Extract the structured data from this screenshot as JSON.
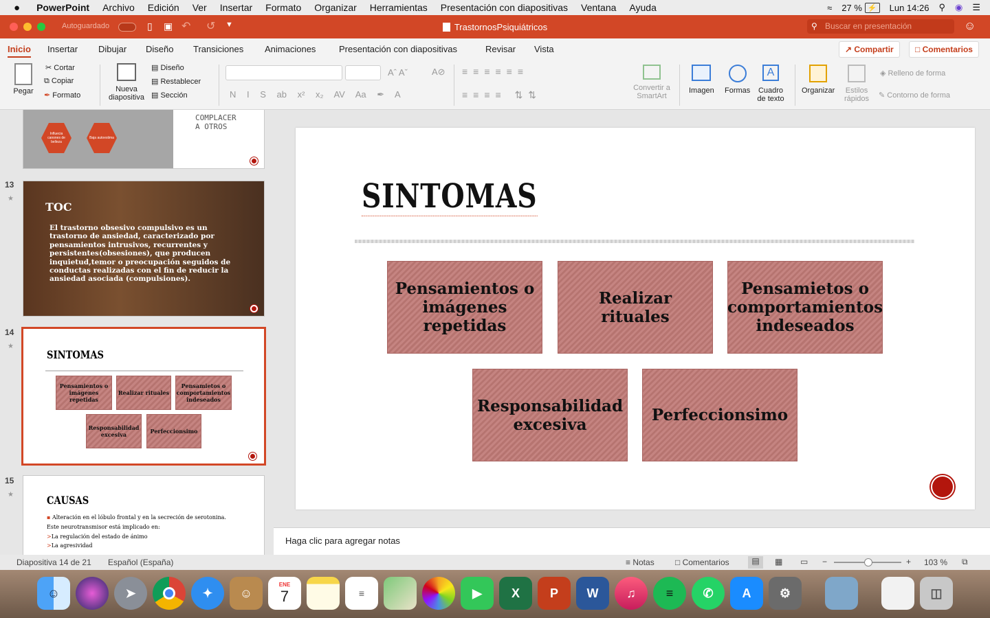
{
  "menubar": {
    "apple": "",
    "app": "PowerPoint",
    "items": [
      "Archivo",
      "Edición",
      "Ver",
      "Insertar",
      "Formato",
      "Organizar",
      "Herramientas",
      "Presentación con diapositivas",
      "Ventana",
      "Ayuda"
    ],
    "battery": "27 %",
    "clock": "Lun 14:26"
  },
  "titlebar": {
    "autosave": "Autoguardado",
    "doc_title": "TrastornosPsiquiátricos",
    "search_placeholder": "Buscar en presentación"
  },
  "tabs": {
    "items": [
      "Inicio",
      "Insertar",
      "Dibujar",
      "Diseño",
      "Transiciones",
      "Animaciones",
      "Presentación con diapositivas",
      "Revisar",
      "Vista"
    ],
    "share": "Compartir",
    "comments": "Comentarios"
  },
  "ribbon": {
    "paste": "Pegar",
    "cut": "Cortar",
    "copy": "Copiar",
    "format": "Formato",
    "new_slide": "Nueva diapositiva",
    "layout": "Diseño",
    "reset": "Restablecer",
    "section": "Sección",
    "convert": "Convertir a SmartArt",
    "image": "Imagen",
    "shapes": "Formas",
    "textbox": "Cuadro de texto",
    "arrange": "Organizar",
    "quick_styles": "Estilos rápidos",
    "shape_fill": "Relleno de forma",
    "shape_outline": "Contorno de forma"
  },
  "panel": {
    "s12": {
      "hex1": "Influecia canones de belleza",
      "hex2": "Baja autoestima",
      "caption": "COMPLACER A OTROS"
    },
    "s13": {
      "num": "13",
      "title": "TOC",
      "text": "El trastorno obsesivo compulsivo es un trastorno de ansiedad, caracterizado por pensamientos intrusivos, recurrentes y persistentes(obsesiones), que producen inquietud,temor o preocupación seguidos de conductas realizadas con el fin de reducir la ansiedad asociada (compulsiones)."
    },
    "s14": {
      "num": "14",
      "title": "SINTOMAS",
      "boxes": [
        "Pensamientos o imágenes repetidas",
        "Realizar rituales",
        "Pensamietos o comportamientos indeseados",
        "Responsabilidad excesiva",
        "Perfeccionsimo"
      ]
    },
    "s15": {
      "num": "15",
      "title": "CAUSAS",
      "lines": [
        "Alteración en el lóbulo frontal y en la secreción de serotonina.",
        "Este neurotransmisor  está implicado en:",
        "La regulación del estado de ánimo",
        "La agresividad"
      ]
    }
  },
  "slide": {
    "title": "SINTOMAS",
    "boxes": [
      "Pensamientos o imágenes repetidas",
      "Realizar rituales",
      "Pensamietos o comportamientos indeseados",
      "Responsabilidad excesiva",
      "Perfeccionsimo"
    ]
  },
  "notes": {
    "placeholder": "Haga clic para agregar notas"
  },
  "status": {
    "slide_info": "Diapositiva 14 de 21",
    "language": "Español (España)",
    "notes": "Notas",
    "comments": "Comentarios",
    "zoom": "103 %"
  },
  "dock": {
    "calendar_month": "ENE",
    "calendar_day": "7"
  },
  "colors": {
    "accent": "#d24726",
    "box": "#c07a76"
  }
}
